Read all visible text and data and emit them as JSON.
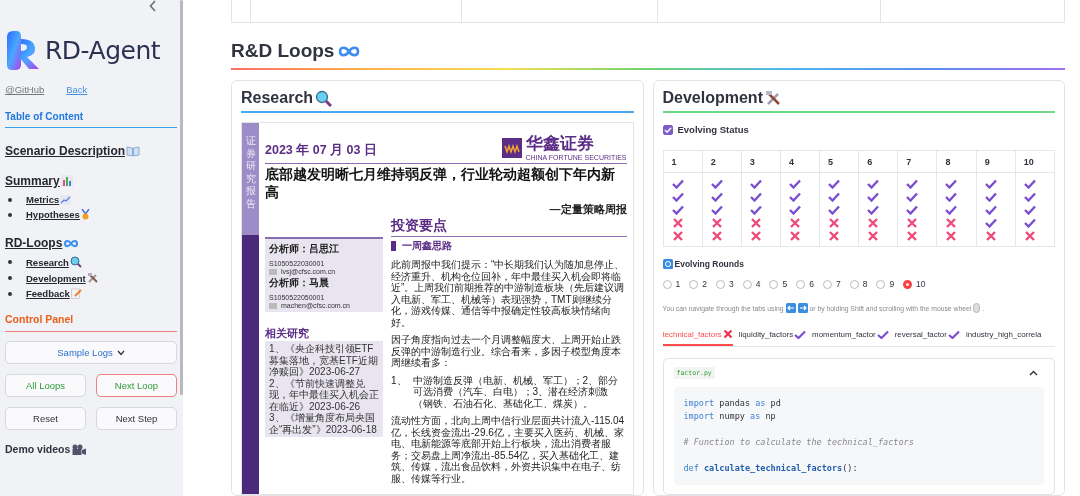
{
  "sidebar": {
    "app_name": "RD-Agent",
    "links": [
      {
        "text": "@GitHub"
      },
      {
        "text": "Back"
      }
    ],
    "toc_heading": "Table of Content",
    "toc": [
      {
        "label": "Scenario Description"
      },
      {
        "label": "Summary",
        "children": [
          {
            "label": "Metrics"
          },
          {
            "label": "Hypotheses"
          }
        ]
      },
      {
        "label": "RD-Loops",
        "children": [
          {
            "label": "Research"
          },
          {
            "label": "Development"
          },
          {
            "label": "Feedback"
          }
        ]
      }
    ],
    "control_heading": "Control Panel",
    "dropdown": "Sample Logs",
    "buttons": [
      {
        "label": "All Loops",
        "kind": "loop",
        "focused": false
      },
      {
        "label": "Next Loop",
        "kind": "loop",
        "focused": true
      },
      {
        "label": "Reset",
        "kind": "step",
        "focused": false
      },
      {
        "label": "Next Step",
        "kind": "step",
        "focused": false
      }
    ],
    "demo_videos": "Demo videos"
  },
  "main": {
    "section_title": "R&D Loops",
    "research": {
      "title": "Research",
      "document": {
        "side_label": "证券研究报告",
        "date": "2023 年 07 月 03 日",
        "brand": "华鑫证券",
        "brand_en": "CHINA FORTUNE SECURITIES",
        "title": "底部越发明晰七月维持弱反弹，行业轮动超额创下年内新高",
        "subtitle": "—定量策略周报",
        "analysts": [
          {
            "label": "分析师：吕思江",
            "id": "S1050522030001",
            "email": "lvsj@cfsc.com.cn"
          },
          {
            "label": "分析师：马晨",
            "id": "S1050522050001",
            "email": "machen@cfsc.com.cn"
          }
        ],
        "related_heading": "相关研究",
        "related": [
          "1、《央企科技引领ETF募集落地，宽基ETF近期净赎回》2023-06-27",
          "2、《节前快速调整兑现，年中最佳买入机会正在临近》2023-06-26",
          "3、《增量角度布局央国企“再出发”》2023-06-18"
        ],
        "key_points_heading": "投资要点",
        "key_points_subheading": "一周鑫思路",
        "blocks": [
          {
            "kind": "para",
            "text": "此前周报中我们提示：“中长期我们认为随加息停止、经济重升、机构仓位回补，年中最佳买入机会即将临近”。上周我们前期推荐的中游制造板块（先后建议调入电新、军工、机械等）表现强势，TMT则继续分化，游戏传媒、通信等中报确定性较高板块情绪向好。"
          },
          {
            "kind": "para",
            "text": "因子角度指向过去一个月调整幅度大、上周开始止跌反弹的中游制造行业。综合看来，多因子模型角度本周继续看多："
          },
          {
            "kind": "list",
            "number": "1、",
            "text": "中游制造反弹（电新、机械、军工）；2、部分可选消费（汽车、白电）；3、潜在经济刺激（钢铁、石油石化、基础化工、煤炭）。"
          },
          {
            "kind": "para",
            "text": "流动性方面，北向上周中信行业层面共计流入-115.04亿，长线资金流出-29.6亿，主要买入医药、机械、家电、电新能源等底部开始上行板块，流出消费者服务；交易盘上周净流出-85.54亿，买入基础化工、建筑、传媒，流出食品饮料，外资共识集中在电子、纺服、传媒等行业。"
          }
        ]
      }
    },
    "development": {
      "title": "Development",
      "evolving_status": {
        "label": "Evolving Status",
        "checked": true
      },
      "status_table": {
        "columns": [
          {
            "header": "1",
            "results": [
              true,
              true,
              true,
              false,
              false
            ]
          },
          {
            "header": "2",
            "results": [
              true,
              true,
              true,
              false,
              false
            ]
          },
          {
            "header": "3",
            "results": [
              true,
              true,
              true,
              false,
              false
            ]
          },
          {
            "header": "4",
            "results": [
              true,
              true,
              true,
              false,
              false
            ]
          },
          {
            "header": "5",
            "results": [
              true,
              true,
              true,
              false,
              false
            ]
          },
          {
            "header": "6",
            "results": [
              true,
              true,
              true,
              false,
              false
            ]
          },
          {
            "header": "7",
            "results": [
              true,
              true,
              true,
              false,
              false
            ]
          },
          {
            "header": "8",
            "results": [
              true,
              true,
              true,
              false,
              false
            ]
          },
          {
            "header": "9",
            "results": [
              true,
              true,
              true,
              true,
              false
            ]
          },
          {
            "header": "10",
            "results": [
              true,
              true,
              true,
              true,
              false
            ]
          }
        ]
      },
      "rounds_label": "Evolving Rounds",
      "rounds": [
        {
          "label": "1",
          "selected": false
        },
        {
          "label": "2",
          "selected": false
        },
        {
          "label": "3",
          "selected": false
        },
        {
          "label": "4",
          "selected": false
        },
        {
          "label": "5",
          "selected": false
        },
        {
          "label": "6",
          "selected": false
        },
        {
          "label": "7",
          "selected": false
        },
        {
          "label": "8",
          "selected": false
        },
        {
          "label": "9",
          "selected": false
        },
        {
          "label": "10",
          "selected": true
        }
      ],
      "hint": [
        "You can navigate through the tabs using",
        "or by holding Shift and scrolling with the mouse wheel",
        "."
      ],
      "tabs": [
        {
          "label": "technical_factors",
          "passed": false,
          "selected": true
        },
        {
          "label": "liquidity_factors",
          "passed": true,
          "selected": false
        },
        {
          "label": "momentum_factor",
          "passed": true,
          "selected": false
        },
        {
          "label": "reversal_factor",
          "passed": true,
          "selected": false
        },
        {
          "label": "industry_high_correla",
          "selected": false
        }
      ],
      "expander": {
        "label": "factor.py",
        "expanded": true,
        "code": [
          {
            "gap_before": false,
            "tokens": [
              {
                "kind": "kw",
                "text": "import"
              },
              {
                "kind": "plain",
                "text": " pandas "
              },
              {
                "kind": "kw",
                "text": "as"
              },
              {
                "kind": "plain",
                "text": " pd"
              }
            ]
          },
          {
            "gap_before": false,
            "tokens": [
              {
                "kind": "kw",
                "text": "import"
              },
              {
                "kind": "plain",
                "text": " numpy "
              },
              {
                "kind": "kw",
                "text": "as"
              },
              {
                "kind": "plain",
                "text": " np"
              }
            ]
          },
          {
            "gap_before": true,
            "tokens": [
              {
                "kind": "comment",
                "text": "# Function to calculate the technical_factors"
              }
            ]
          },
          {
            "gap_before": true,
            "tokens": [
              {
                "kind": "kw",
                "text": "def "
              },
              {
                "kind": "fn",
                "text": "calculate_technical_factors"
              },
              {
                "kind": "plain",
                "text": "():"
              }
            ]
          }
        ]
      }
    }
  }
}
